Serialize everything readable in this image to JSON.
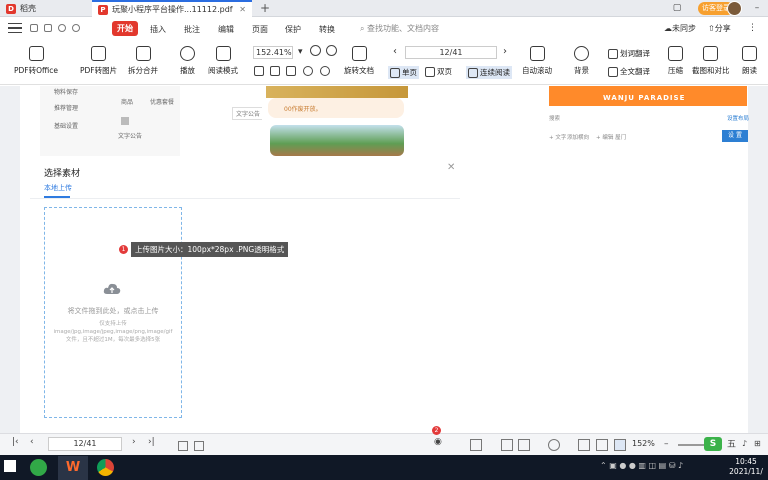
{
  "tabs": [
    {
      "label": "稻壳"
    },
    {
      "label": "玩聚小程序平台操作...11112.pdf"
    }
  ],
  "menu": {
    "items": [
      "开始",
      "插入",
      "批注",
      "编辑",
      "页面",
      "保护",
      "转换"
    ],
    "search_placeholder": "查找功能、文档内容",
    "sync_label": "未同步",
    "share_label": "分享",
    "user_label": "访客登录"
  },
  "toolbar": {
    "pdf_to_office": "PDF转Office",
    "pdf_to_image": "PDF转图片",
    "split_merge": "拆分合并",
    "play": "播放",
    "read_mode": "阅读模式",
    "zoom": "152.41%",
    "rotate_doc": "旋转文档",
    "page_indicator": "12/41",
    "single_page": "单页",
    "double_page": "双页",
    "continuous": "连续阅读",
    "auto_scroll": "自动滚动",
    "background": "背景",
    "word_translate": "划词翻译",
    "full_translate": "全文翻译",
    "compress": "压缩",
    "screenshot_compare": "截图和对比",
    "read_aloud": "朗读"
  },
  "preview": {
    "left_items": [
      "物料保存",
      "推荐管理",
      "基础设置"
    ],
    "left_labels": [
      "商品",
      "优惠套餐",
      "文字公告"
    ],
    "float_label": "文字公告",
    "phone_banner": "00作废开放。",
    "brand": "WANJU PARADISE",
    "right_small": [
      "搜索",
      "设置布局",
      "+ 文字",
      "添加横向",
      "+ 编辑 屋门"
    ],
    "right_button": "设 置"
  },
  "dialog": {
    "title": "选择素材",
    "tab": "本地上传",
    "upload_text": "将文件拖到此处，或点击上传",
    "upload_hint": "仅支持上传image/jpg,image/jpeg,image/png,image/gif文件，且不超过1M，每次最多选择5张",
    "tooltip": "上传图片大小：100px*28px .PNG透明格式",
    "tooltip_badge": "1",
    "status_badge": "2"
  },
  "statusbar": {
    "page": "12/41",
    "zoom": "152%"
  },
  "taskbar": {
    "time": "10:45",
    "date": "2021/11/"
  },
  "colors": {
    "accent": "#e2382d",
    "link": "#2f7be0",
    "brand_orange": "#ff8a2a"
  }
}
